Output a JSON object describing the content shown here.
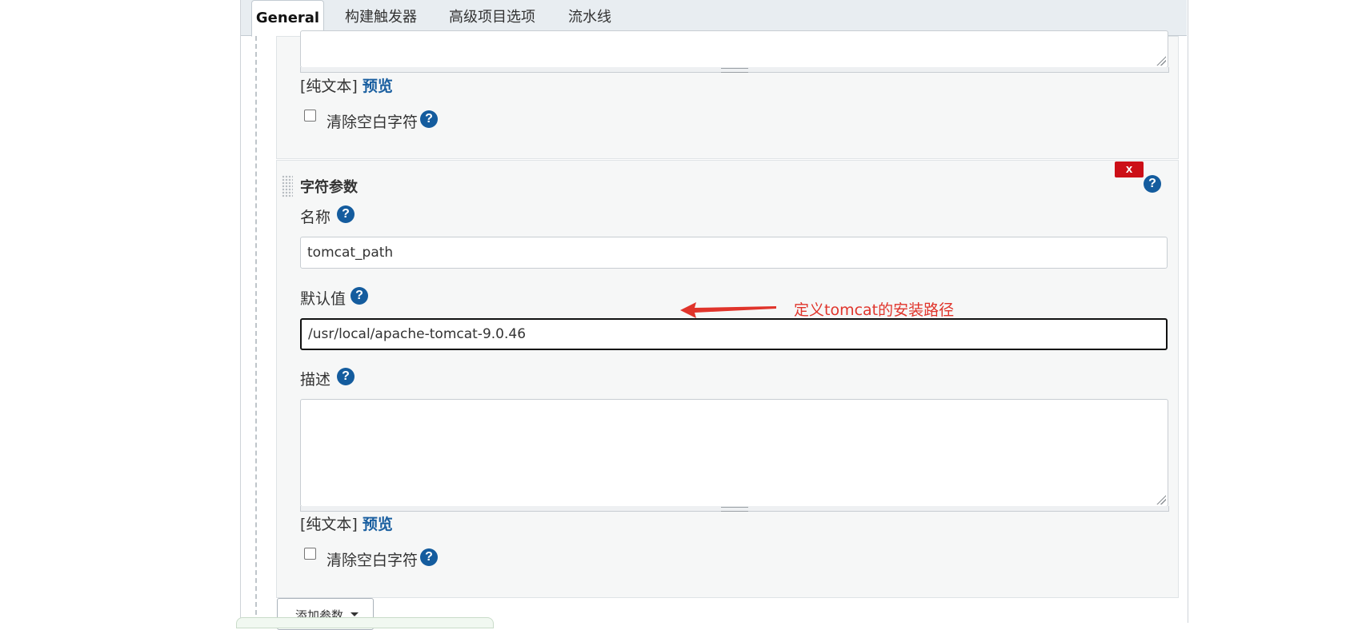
{
  "tabs": [
    {
      "label": "General",
      "active": true
    },
    {
      "label": "构建触发器",
      "active": false
    },
    {
      "label": "高级项目选项",
      "active": false
    },
    {
      "label": "流水线",
      "active": false
    }
  ],
  "prev_param": {
    "format_label": "[纯文本]",
    "preview_label": "预览",
    "trim_label": "清除空白字符"
  },
  "string_param": {
    "title": "字符参数",
    "delete_label": "x",
    "name_label": "名称",
    "name_value": "tomcat_path",
    "default_label": "默认值",
    "default_value": "/usr/local/apache-tomcat-9.0.46",
    "desc_label": "描述",
    "format_label": "[纯文本]",
    "preview_label": "预览",
    "trim_label": "清除空白字符"
  },
  "help_glyph": "?",
  "annotation": {
    "text": "定义tomcat的安装路径",
    "color": "#e0342b"
  },
  "add_param_label": "添加参数",
  "colors": {
    "link": "#1a5fa0",
    "help_icon": "#145c9e",
    "delete": "#cc0f17"
  }
}
